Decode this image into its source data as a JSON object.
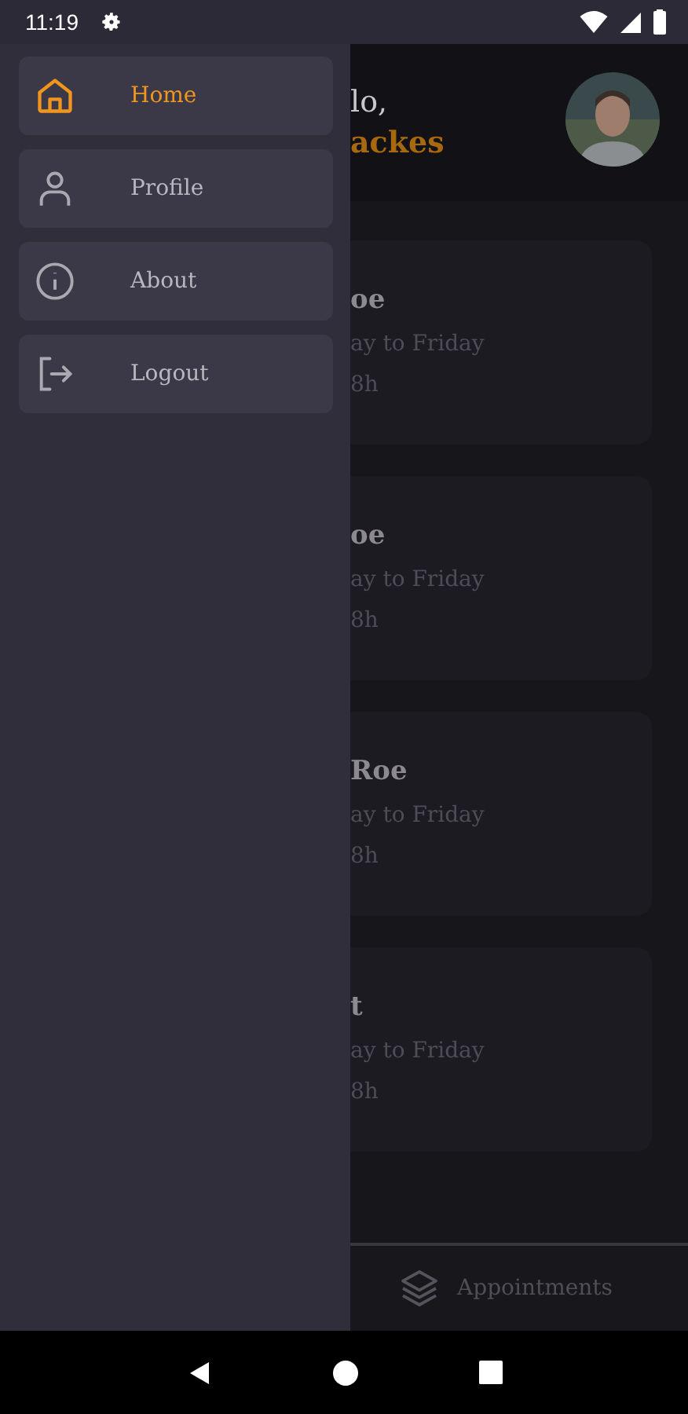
{
  "status_bar": {
    "time": "11:19"
  },
  "drawer": {
    "items": [
      {
        "label": "Home",
        "kind": "home",
        "selected": true
      },
      {
        "label": "Profile",
        "kind": "person",
        "selected": false
      },
      {
        "label": "About",
        "kind": "info",
        "selected": false
      },
      {
        "label": "Logout",
        "kind": "logout",
        "selected": false
      }
    ]
  },
  "main": {
    "greeting": "lo,",
    "name": "ackes",
    "cards": [
      {
        "name": "oe",
        "days": "ay to Friday",
        "hours": "8h"
      },
      {
        "name": "oe",
        "days": "ay to Friday",
        "hours": "8h"
      },
      {
        "name": "Roe",
        "days": "ay to Friday",
        "hours": "8h"
      },
      {
        "name": "t",
        "days": "ay to Friday",
        "hours": "8h"
      }
    ]
  },
  "bottom_nav": {
    "items": [
      {
        "label": "Appointments"
      }
    ]
  }
}
